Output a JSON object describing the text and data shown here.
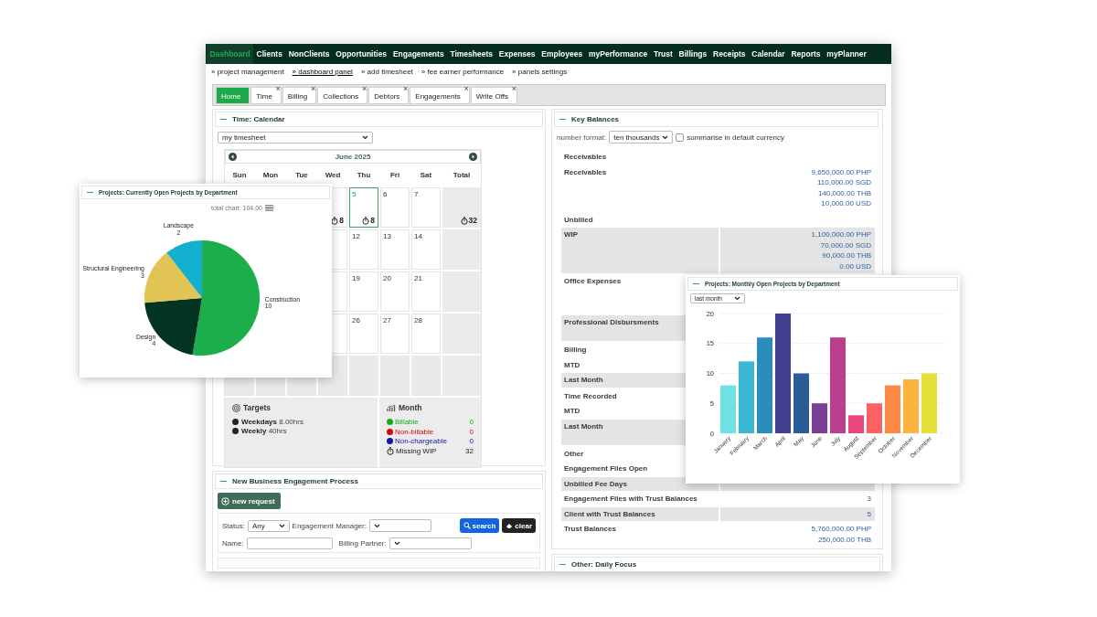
{
  "nav": [
    {
      "label": "Dashboard",
      "selected": true
    },
    {
      "label": "Clients",
      "selected": false
    },
    {
      "label": "NonClients",
      "selected": false
    },
    {
      "label": "Opportunities",
      "selected": false
    },
    {
      "label": "Engagements",
      "selected": false
    },
    {
      "label": "Timesheets",
      "selected": false
    },
    {
      "label": "Expenses",
      "selected": false
    },
    {
      "label": "Employees",
      "selected": false
    },
    {
      "label": "myPerformance",
      "selected": false
    },
    {
      "label": "Trust",
      "selected": false
    },
    {
      "label": "Billings",
      "selected": false
    },
    {
      "label": "Receipts",
      "selected": false
    },
    {
      "label": "Calendar",
      "selected": false
    },
    {
      "label": "Reports",
      "selected": false
    },
    {
      "label": "myPlanner",
      "selected": false
    }
  ],
  "subnav": [
    {
      "bullet": "»",
      "label": "project management",
      "selected": false
    },
    {
      "bullet": "»",
      "label": "dashboard panel",
      "selected": true
    },
    {
      "bullet": "»",
      "label": "add timesheet",
      "selected": false
    },
    {
      "bullet": "»",
      "label": "fee earner performance",
      "selected": false
    },
    {
      "bullet": "»",
      "label": "panels settings",
      "selected": false
    }
  ],
  "tabs": [
    {
      "label": "Home",
      "selected": true
    },
    {
      "label": "Time",
      "selected": false,
      "close": "×"
    },
    {
      "label": "Billing",
      "selected": false,
      "close": "×"
    },
    {
      "label": "Collections",
      "selected": false,
      "close": "×"
    },
    {
      "label": "Debtors",
      "selected": false,
      "close": "×"
    },
    {
      "label": "Engagements",
      "selected": false,
      "close": "×"
    },
    {
      "label": "Write Offs",
      "selected": false,
      "close": "×"
    }
  ],
  "calendar_panel": {
    "title": "Time: Calendar",
    "view": "my timesheet",
    "month": "June 2025",
    "weekdays": [
      "Sun",
      "Mon",
      "Tue",
      "Wed",
      "Thu",
      "Fri",
      "Sat",
      "Total"
    ],
    "weeks": [
      {
        "days": [
          {
            "hours": "8"
          },
          {
            "day": "5",
            "hours": "8",
            "today": true
          },
          {
            "day": "6"
          },
          {
            "day": "7"
          }
        ],
        "total": "32"
      },
      {
        "days": [
          {
            "day": "12"
          },
          {
            "day": "13"
          },
          {
            "day": "14"
          }
        ]
      },
      {
        "days": [
          {
            "day": "19"
          },
          {
            "day": "20"
          },
          {
            "day": "21"
          }
        ]
      },
      {
        "days": [
          {
            "day": "26"
          },
          {
            "day": "27"
          },
          {
            "day": "28"
          }
        ]
      },
      {
        "days": [
          {
            "outside": true
          },
          {
            "outside": true
          },
          {
            "outside": true
          },
          {
            "outside": true
          },
          {
            "outside": true
          },
          {
            "outside": true
          },
          {
            "outside": true
          }
        ]
      }
    ],
    "targets": {
      "title": "Targets",
      "items": [
        "**Weekdays** 8.00hrs",
        "**Weekly** 40hrs"
      ]
    },
    "month_summary": {
      "title": "Month",
      "items": [
        {
          "kind": "category",
          "label": "Billable",
          "value": "0",
          "color": "#18a81c"
        },
        {
          "kind": "category",
          "label": "Non-billable",
          "value": "0",
          "color": "#cc0a0a"
        },
        {
          "kind": "category",
          "label": "Non-chargeable",
          "value": "0",
          "color": "#1414a8"
        },
        {
          "kind": "timer",
          "label": "Missing WIP",
          "value": "32"
        }
      ]
    }
  },
  "engagement_panel": {
    "title": "New Business Engagement Process",
    "new_button": "new request",
    "status_label": "Status:",
    "status": "Any",
    "manager_label": "Engagement Manager:",
    "search_button": "search",
    "clear_button": "clear",
    "name_label": "Name:",
    "partner_label": "Billing Partner:"
  },
  "key_balances": {
    "title": "Key Balances",
    "format_label": "number format:",
    "format": "ten thousands",
    "summarise": {
      "label": "summarise in default currency",
      "checked": false
    },
    "rows": [
      {
        "kind": "section",
        "label": "Receivables"
      },
      {
        "kind": "row",
        "label": "Receivables",
        "shaded": false,
        "values": [
          "9,650,000.00 PHP",
          "110,000.00 SGD",
          "140,000.00 THB",
          "10,000.00 USD"
        ]
      },
      {
        "kind": "section",
        "label": "Unbilled"
      },
      {
        "kind": "row",
        "label": "WIP",
        "shaded": true,
        "values": [
          "1,100,000.00 PHP",
          "70,000.00 SGD",
          "90,000.00 THB",
          "0.00 USD"
        ]
      },
      {
        "kind": "block",
        "label": "Office Expenses",
        "shaded": false
      },
      {
        "kind": "tall",
        "label": "Professional Disbursments",
        "shaded": true
      },
      {
        "kind": "section",
        "label": "Billing"
      },
      {
        "kind": "row",
        "label": "MTD",
        "shaded": false
      },
      {
        "kind": "row",
        "label": "Last Month",
        "shaded": true
      },
      {
        "kind": "section",
        "label": "Time Recorded"
      },
      {
        "kind": "row",
        "label": "MTD",
        "shaded": false
      },
      {
        "kind": "tall",
        "label": "Last Month",
        "shaded": true
      },
      {
        "kind": "section",
        "label": "Other"
      },
      {
        "kind": "row",
        "label": "Engagement Files Open",
        "shaded": false
      },
      {
        "kind": "row",
        "label": "Unbilled Fee Days",
        "shaded": true
      },
      {
        "kind": "row",
        "label": "Engagement Files with Trust Balances",
        "shaded": false,
        "values": [
          "3"
        ]
      },
      {
        "kind": "row",
        "label": "Client with Trust Balances",
        "shaded": true,
        "values": [
          "5"
        ]
      },
      {
        "kind": "row",
        "label": "Trust Balances",
        "shaded": false,
        "values": [
          "5,760,000.00 PHP",
          "250,000.00 THB"
        ]
      }
    ]
  },
  "focus_panel": {
    "title": "Other: Daily Focus"
  },
  "pie_panel": {
    "title": "Projects: Currently Open Projects by Department",
    "total": "total chart: 104.00",
    "chart_data": {
      "type": "pie",
      "categories": [
        "Construction",
        "Design",
        "Structural Engineering",
        "Landscape"
      ],
      "values": [
        10,
        4,
        3,
        2
      ],
      "colors": [
        "#1bae4b",
        "#033321",
        "#e1c453",
        "#12b0ce"
      ],
      "data_labels": true
    }
  },
  "bar_panel": {
    "title": "Projects: Monthly Open Projects by Department",
    "period": "last month",
    "chart_data": {
      "type": "bar",
      "categories": [
        "January",
        "February",
        "March",
        "April",
        "May",
        "June",
        "July",
        "August",
        "September",
        "October",
        "November",
        "December"
      ],
      "values": [
        8,
        12,
        16,
        20,
        10,
        5,
        16,
        3,
        5,
        8,
        9,
        10
      ],
      "grid": true,
      "colors": [
        "#6ee1e3",
        "#3bb8d4",
        "#2a8dbd",
        "#433f8f",
        "#2b5c97",
        "#7b3f97",
        "#b93e8c",
        "#e9467c",
        "#fc6165",
        "#fd8845",
        "#fbb53f",
        "#e6e03b"
      ],
      "ylim": [
        0,
        20
      ],
      "yticks": [
        0,
        5,
        10,
        15,
        20
      ]
    }
  }
}
